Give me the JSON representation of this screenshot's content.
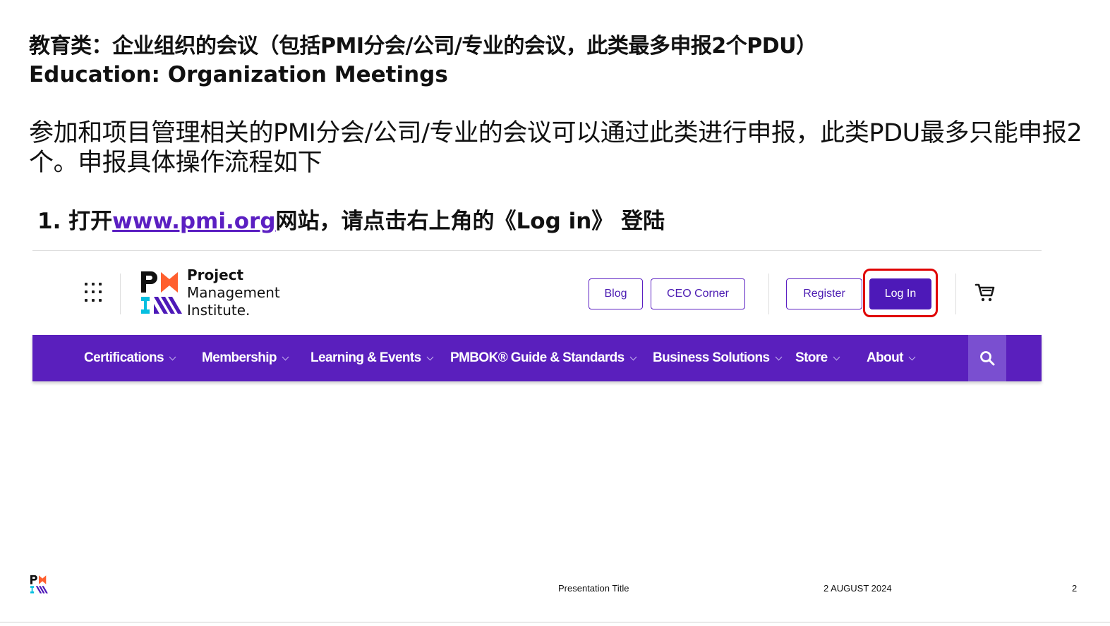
{
  "slide": {
    "title_cn": "教育类：企业组织的会议（包括PMI分会/公司/专业的会议，此类最多申报2个PDU）",
    "title_en": "Education: Organization Meetings",
    "description": "参加和项目管理相关的PMI分会/公司/专业的会议可以通过此类进行申报，此类PDU最多只能申报2个。申报具体操作流程如下",
    "step": {
      "number": "1.",
      "prefix": "打开",
      "link_text": "www.pmi.org",
      "suffix": "网站，请点击右上角的《Log in》 登陆"
    }
  },
  "screenshot": {
    "brand": {
      "line1": "Project",
      "line2": "Management",
      "line3": "Institute."
    },
    "header_buttons": {
      "blog": "Blog",
      "ceo_corner": "CEO Corner",
      "register": "Register",
      "login": "Log In"
    },
    "nav": [
      {
        "label": "Certifications"
      },
      {
        "label": "Membership"
      },
      {
        "label": "Learning & Events"
      },
      {
        "label": "PMBOK® Guide & Standards"
      },
      {
        "label": "Business Solutions"
      },
      {
        "label": "Store"
      },
      {
        "label": "About"
      }
    ],
    "colors": {
      "brand_purple": "#5a1fbd",
      "highlight_red": "#e00000",
      "logo_teal": "#05bfe0"
    },
    "icons": [
      "grid-menu-icon",
      "cart-icon",
      "search-icon"
    ]
  },
  "footer": {
    "presentation_title": "Presentation Title",
    "date": "2 AUGUST 2024",
    "page_number": "2"
  }
}
